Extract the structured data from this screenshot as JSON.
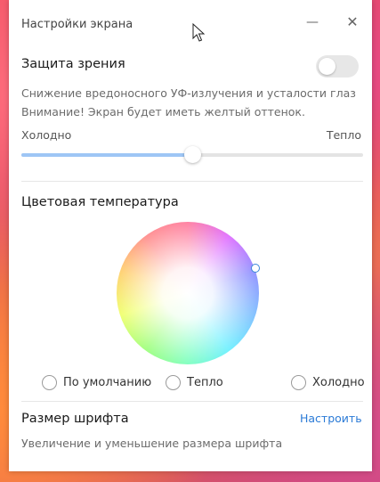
{
  "window": {
    "title": "Настройки экрана",
    "minimize_glyph": "—",
    "close_glyph": "✕"
  },
  "eye_protection": {
    "title": "Защита зрения",
    "toggle_on": false,
    "desc_line1": "Снижение вредоносного УФ-излучения и усталости глаз",
    "desc_line2": "Внимание! Экран будет иметь желтый оттенок.",
    "slider": {
      "left_label": "Холодно",
      "right_label": "Тепло",
      "value_fraction": 0.5
    }
  },
  "color_temperature": {
    "title": "Цветовая температура",
    "options": [
      {
        "label": "По умолчанию",
        "selected": false
      },
      {
        "label": "Тепло",
        "selected": false
      },
      {
        "label": "Холодно",
        "selected": false
      }
    ]
  },
  "font_size": {
    "title": "Размер шрифта",
    "action": "Настроить",
    "desc": "Увеличение и уменьшение размера шрифта"
  },
  "colors": {
    "accent": "#2a7ad6",
    "slider_fill": "#9ec6f5"
  }
}
